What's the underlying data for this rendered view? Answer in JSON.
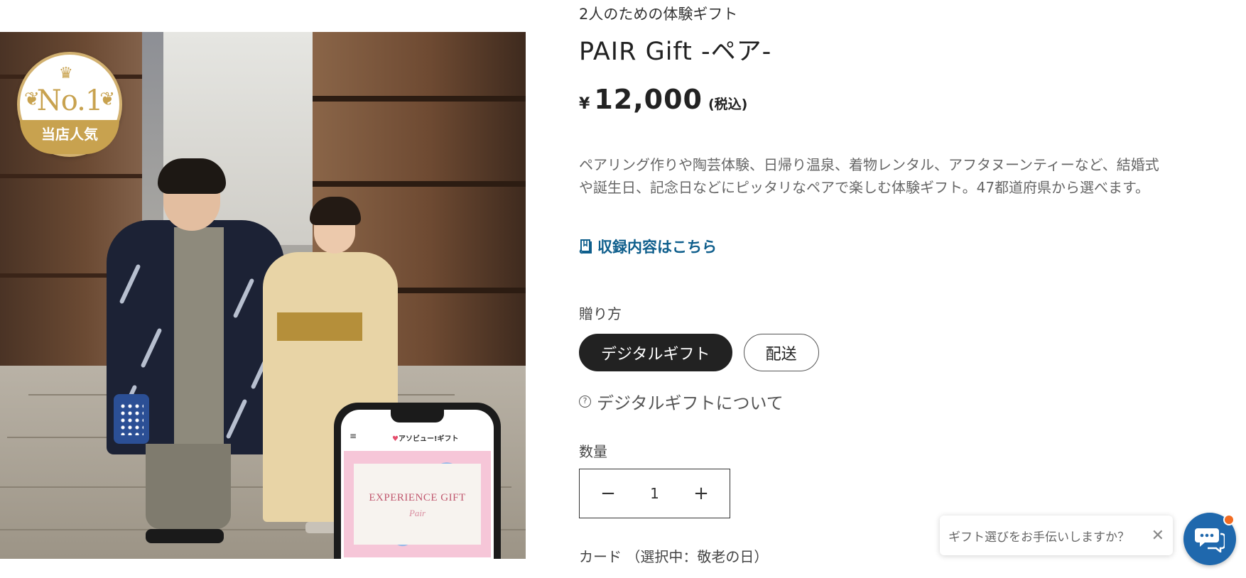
{
  "image": {
    "badge_main": "No.1",
    "badge_sub": "当店人気",
    "phone_menu_icon": "hamburger-icon",
    "phone_app_name": "アソビュー!ギフト",
    "phone_card_title": "EXPERIENCE GIFT",
    "phone_card_subtitle": "Pair"
  },
  "product": {
    "subtitle": "2人のための体験ギフト",
    "title": "PAIR Gift -ペア-",
    "price_currency": "¥",
    "price_amount": "12,000",
    "price_tax": "(税込)",
    "description": "ペアリング作りや陶芸体験、日帰り温泉、着物レンタル、アフタヌーンティーなど、結婚式や誕生日、記念日などにピッタリなペアで楽しむ体験ギフト。47都道府県から選べます。",
    "contents_link": "収録内容はこちら",
    "contents_icon": "book-icon"
  },
  "delivery": {
    "label": "贈り方",
    "options": [
      {
        "label": "デジタルギフト",
        "selected": true
      },
      {
        "label": "配送",
        "selected": false
      }
    ],
    "about_link": "デジタルギフトについて",
    "about_icon": "help-circle-icon"
  },
  "quantity": {
    "label": "数量",
    "value": "1",
    "minus": "−",
    "plus": "+"
  },
  "card": {
    "label": "カード （選択中：敬老の日）"
  },
  "chat": {
    "prompt": "ギフト選びをお手伝いしますか？",
    "close": "✕",
    "icon": "chat-icon",
    "accent": "#1f68ad",
    "notification_color": "#f26b21"
  },
  "colors": {
    "link": "#0e5e8c",
    "selected_pill": "#222222",
    "badge_gold": "#c8a24f"
  }
}
